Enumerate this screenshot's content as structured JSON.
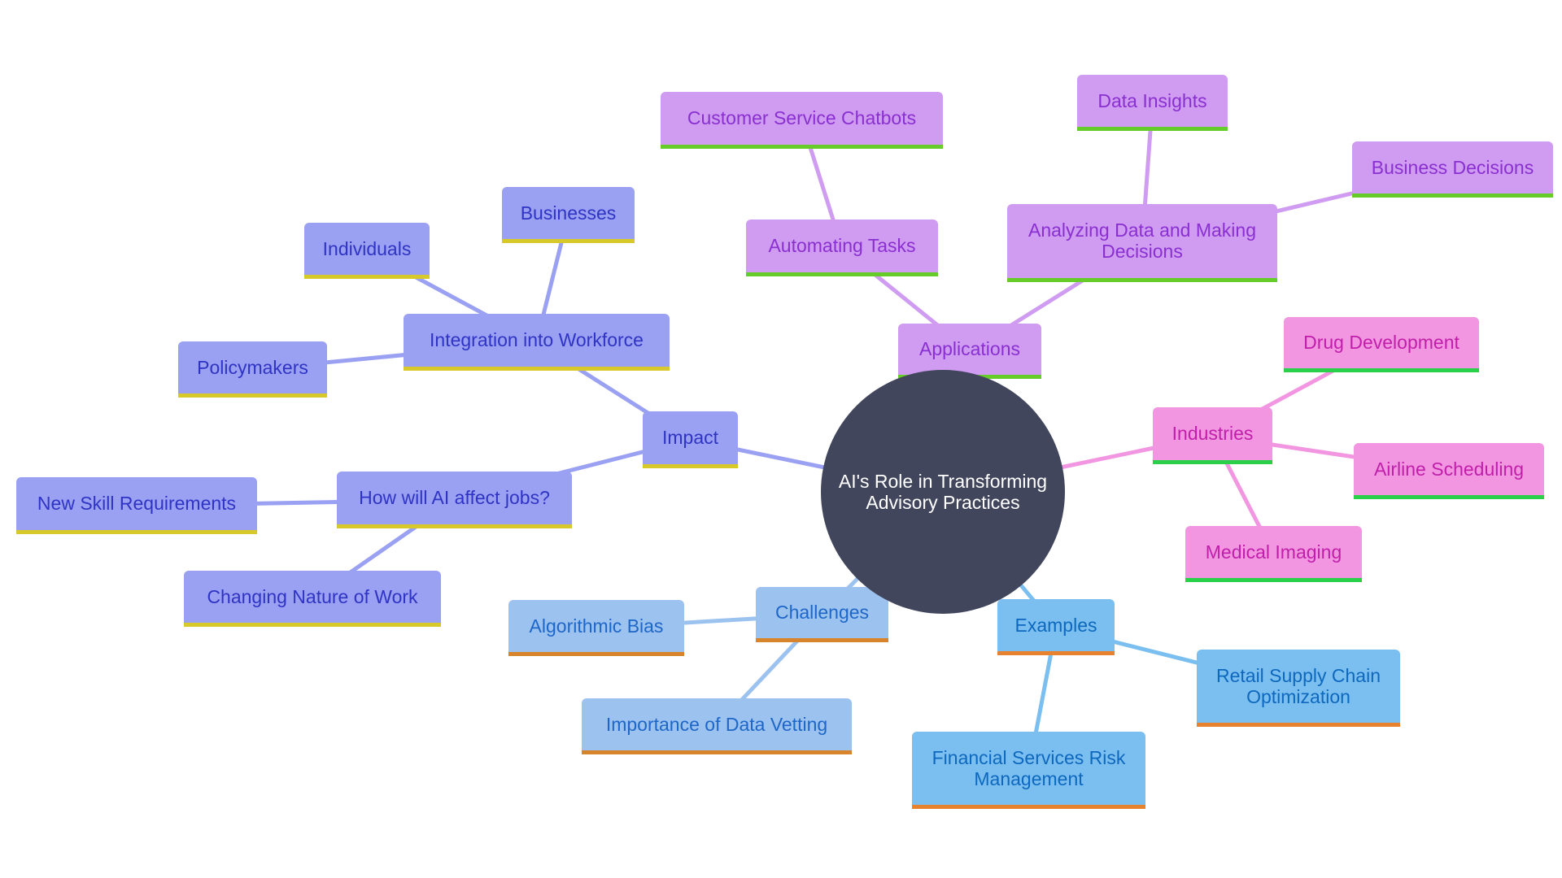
{
  "diagram": {
    "type": "mindmap",
    "root": "AI's Role in Transforming Advisory Practices",
    "branch_colors": {
      "impact": {
        "fill": "#9aa0f2",
        "text": "#2f34c4",
        "underline": "#d8c92a",
        "edge": "#9aa0f2"
      },
      "applications": {
        "fill": "#cf9cf2",
        "text": "#8a2fd0",
        "underline": "#66cc2a",
        "edge": "#cf9cf2"
      },
      "industries": {
        "fill": "#f296e2",
        "text": "#c01faa",
        "underline": "#2ad04a",
        "edge": "#f296e2"
      },
      "challenges": {
        "fill": "#9cc2ef",
        "text": "#1e67c8",
        "underline": "#d8842c",
        "edge": "#9cc2ef"
      },
      "examples": {
        "fill": "#7bbff0",
        "text": "#0d68be",
        "underline": "#e8822e",
        "edge": "#7bbff0"
      },
      "root_fill": "#41465c"
    },
    "nodes": {
      "impact": "Impact",
      "integration": "Integration into Workforce",
      "individuals": "Individuals",
      "businesses": "Businesses",
      "policymakers": "Policymakers",
      "jobs": "How will AI affect jobs?",
      "new_skills": "New Skill Requirements",
      "changing_work": "Changing Nature of Work",
      "applications": "Applications",
      "automating": "Automating Tasks",
      "chatbots": "Customer Service Chatbots",
      "analyzing": "Analyzing Data and Making Decisions",
      "data_insights": "Data Insights",
      "business_decisions": "Business Decisions",
      "industries": "Industries",
      "drug_dev": "Drug Development",
      "airline": "Airline Scheduling",
      "medical": "Medical Imaging",
      "challenges": "Challenges",
      "bias": "Algorithmic Bias",
      "vetting": "Importance of Data Vetting",
      "examples": "Examples",
      "retail": "Retail Supply Chain Optimization",
      "financial": "Financial Services Risk Management"
    },
    "edges": [
      [
        "root",
        "impact"
      ],
      [
        "impact",
        "integration"
      ],
      [
        "integration",
        "individuals"
      ],
      [
        "integration",
        "businesses"
      ],
      [
        "integration",
        "policymakers"
      ],
      [
        "impact",
        "jobs"
      ],
      [
        "jobs",
        "new_skills"
      ],
      [
        "jobs",
        "changing_work"
      ],
      [
        "root",
        "applications"
      ],
      [
        "applications",
        "automating"
      ],
      [
        "automating",
        "chatbots"
      ],
      [
        "applications",
        "analyzing"
      ],
      [
        "analyzing",
        "data_insights"
      ],
      [
        "analyzing",
        "business_decisions"
      ],
      [
        "root",
        "industries"
      ],
      [
        "industries",
        "drug_dev"
      ],
      [
        "industries",
        "airline"
      ],
      [
        "industries",
        "medical"
      ],
      [
        "root",
        "challenges"
      ],
      [
        "challenges",
        "bias"
      ],
      [
        "challenges",
        "vetting"
      ],
      [
        "root",
        "examples"
      ],
      [
        "examples",
        "retail"
      ],
      [
        "examples",
        "financial"
      ]
    ]
  }
}
